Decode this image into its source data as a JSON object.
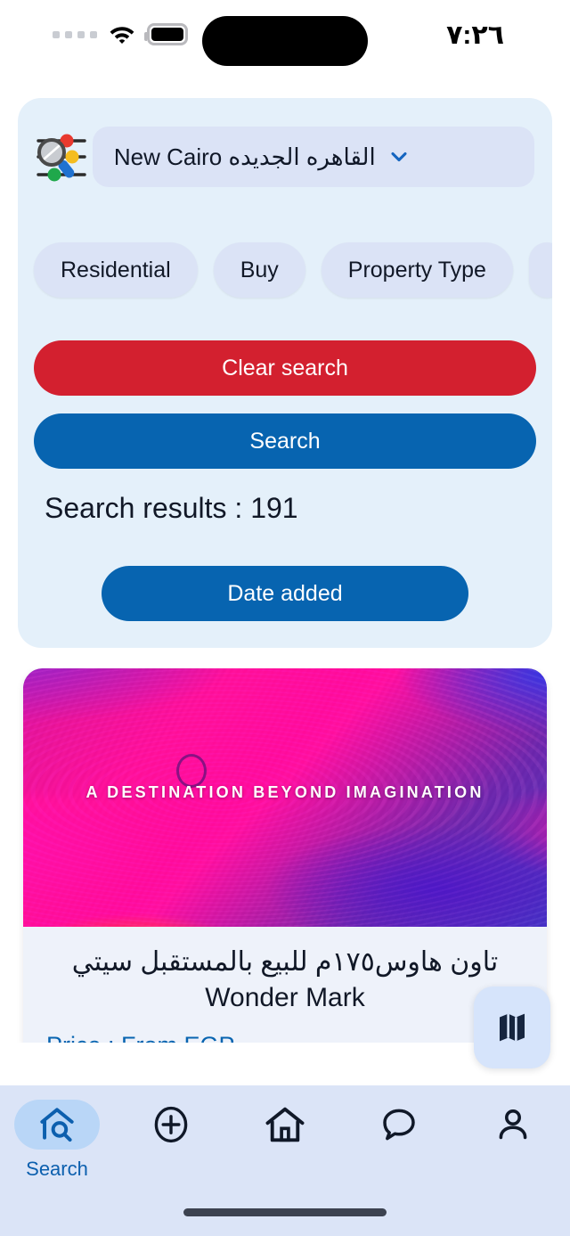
{
  "status_bar": {
    "time": "٧:٢٦",
    "battery_icon": "battery-icon",
    "wifi_icon": "wifi-icon",
    "signal_icon": "signal-dots-icon"
  },
  "search_panel": {
    "location": {
      "value": "القاهره الجديده New Cairo",
      "chevron_icon": "chevron-down-icon"
    },
    "filter_icon": "search-filter-settings-icon",
    "chips": [
      {
        "label": "Residential"
      },
      {
        "label": "Buy"
      },
      {
        "label": "Property Type"
      },
      {
        "label": ""
      }
    ],
    "clear_button": "Clear search",
    "search_button": "Search",
    "results_text": "Search results : 191",
    "results_count": 191,
    "sort_button": "Date added"
  },
  "property_card": {
    "image_caption": "A DESTINATION BEYOND IMAGINATION",
    "title": "تاون هاوس١٧٥م  للبيع بالمستقبل سيتي Wonder Mark",
    "price": "Price : From EGP"
  },
  "map_fab": {
    "icon": "map-icon"
  },
  "bottom_nav": {
    "items": [
      {
        "label": "Search",
        "icon": "house-search-icon",
        "active": true
      },
      {
        "label": "",
        "icon": "plus-circle-icon",
        "active": false
      },
      {
        "label": "",
        "icon": "home-icon",
        "active": false
      },
      {
        "label": "",
        "icon": "chat-bubble-icon",
        "active": false
      },
      {
        "label": "",
        "icon": "person-icon",
        "active": false
      }
    ]
  },
  "colors": {
    "panel_bg": "#e4f0fa",
    "chip_bg": "#dbe3f6",
    "primary_blue": "#0764b0",
    "danger_red": "#d3202f",
    "nav_bg": "#dbe4f7",
    "nav_active_pill": "#b9d6f7",
    "card_bg": "#eef2fa",
    "fab_bg": "#d6e4fb"
  }
}
